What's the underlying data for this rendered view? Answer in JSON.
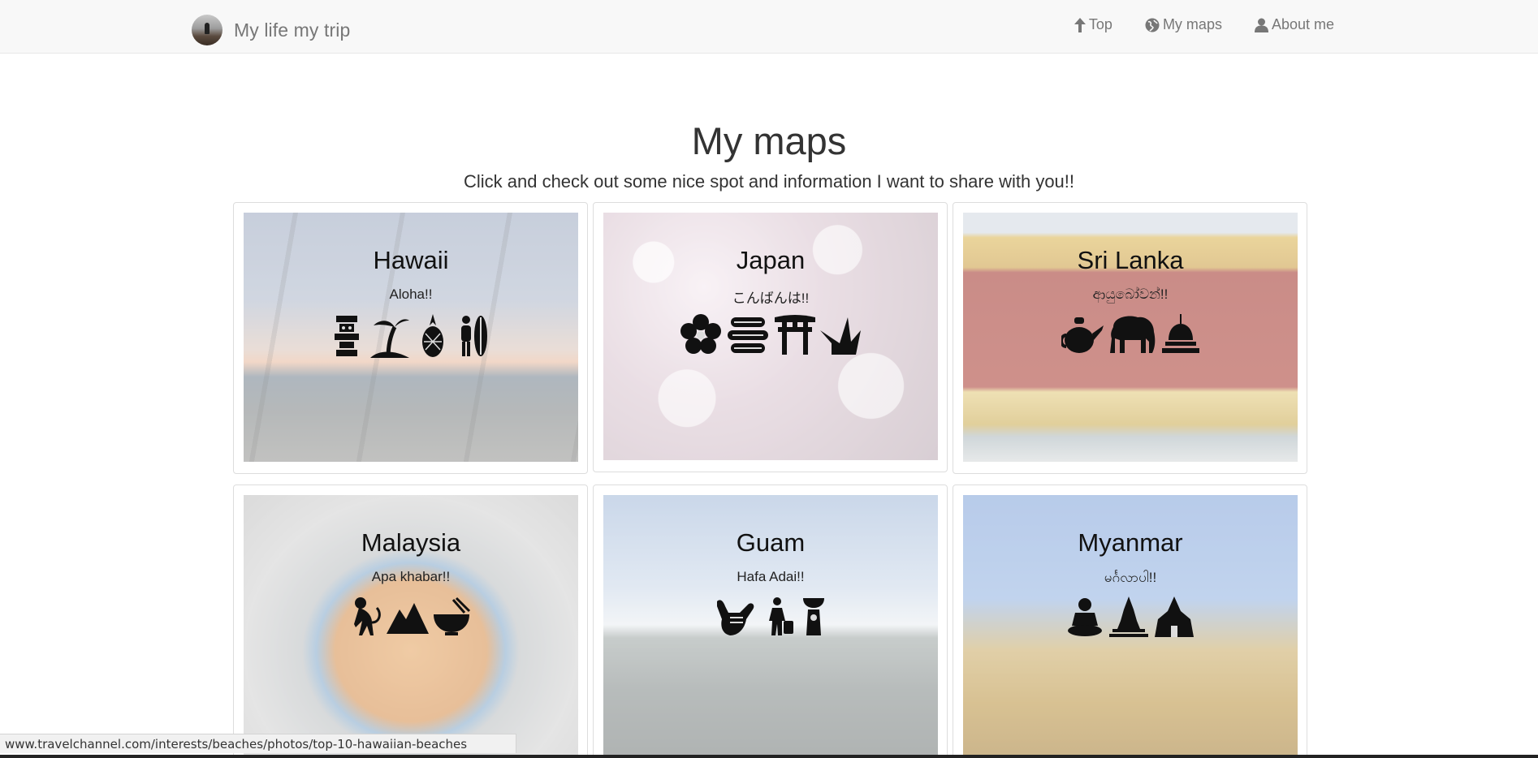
{
  "navbar": {
    "brand": "My life my trip",
    "links": [
      {
        "label": "Top",
        "icon": "arrow-up-icon"
      },
      {
        "label": "My maps",
        "icon": "globe-icon"
      },
      {
        "label": "About me",
        "icon": "user-icon"
      }
    ]
  },
  "header": {
    "title": "My maps",
    "subtitle": "Click and check out some nice spot and information I want to share with you!!"
  },
  "cards": [
    {
      "title": "Hawaii",
      "greeting": "Aloha!!",
      "icons": [
        "tiki-icon",
        "palm-island-icon",
        "pineapple-icon",
        "surfer-icon"
      ]
    },
    {
      "title": "Japan",
      "greeting": "こんばんは!!",
      "icons": [
        "sakura-icon",
        "sushi-icon",
        "torii-icon",
        "paper-crane-icon"
      ]
    },
    {
      "title": "Sri Lanka",
      "greeting": "ආයුබෝවන්!!",
      "icons": [
        "teapot-icon",
        "elephant-icon",
        "stupa-icon"
      ]
    },
    {
      "title": "Malaysia",
      "greeting": "Apa khabar!!",
      "icons": [
        "monkey-icon",
        "mountain-icon",
        "noodle-bowl-icon"
      ]
    },
    {
      "title": "Guam",
      "greeting": "Hafa Adai!!",
      "icons": [
        "shaka-hand-icon",
        "traveler-icon",
        "latte-stone-icon"
      ]
    },
    {
      "title": "Myanmar",
      "greeting": "မင်္ဂလာပါ!!",
      "icons": [
        "buddha-icon",
        "pagoda-icon",
        "temple-icon"
      ]
    }
  ],
  "status_url": "www.travelchannel.com/interests/beaches/photos/top-10-hawaiian-beaches"
}
